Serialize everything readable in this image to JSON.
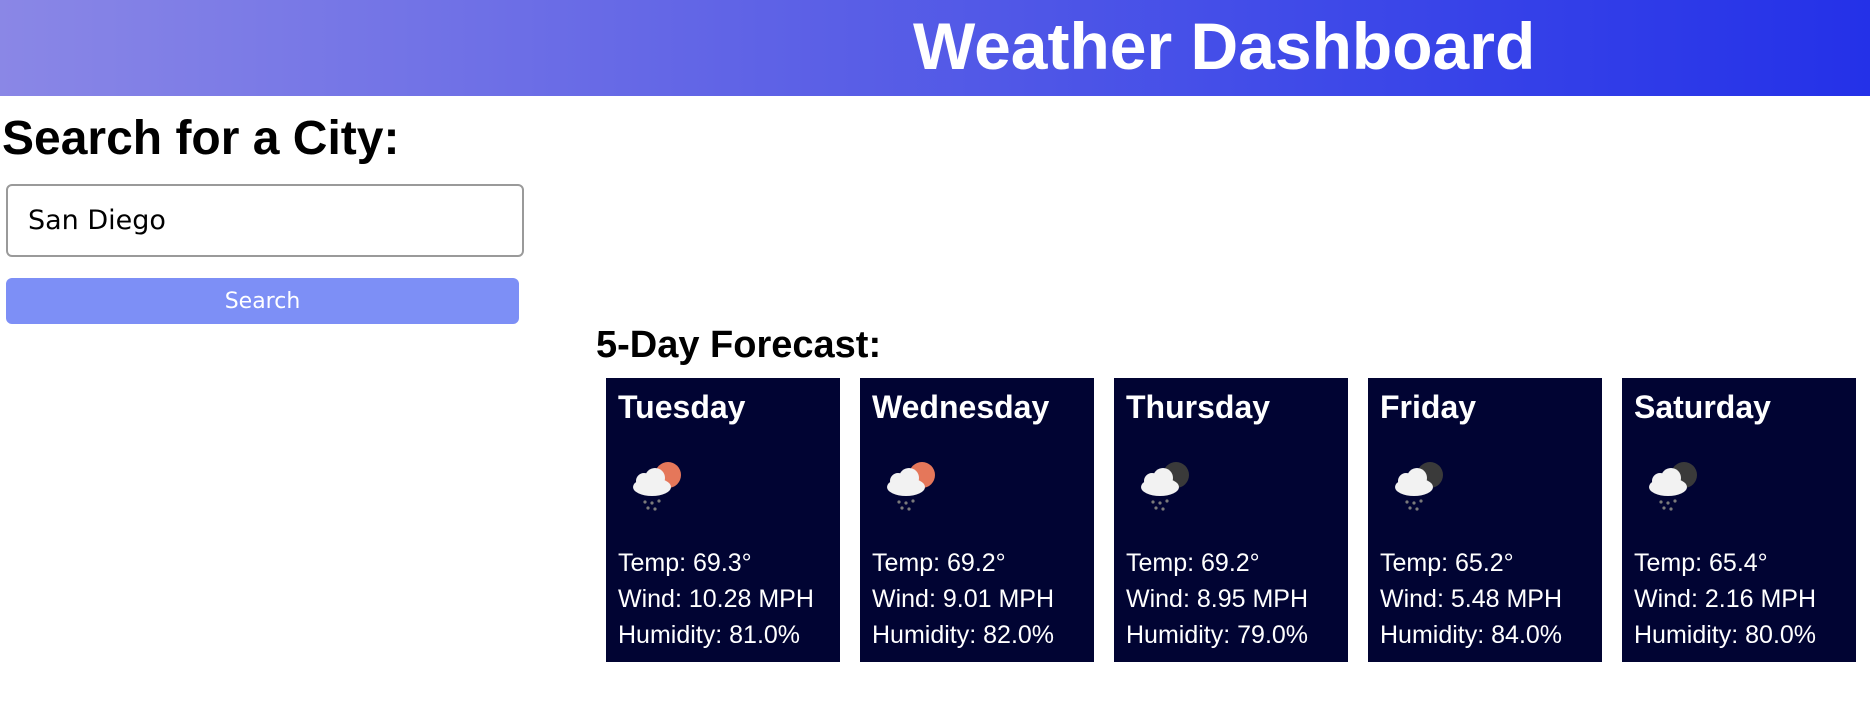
{
  "header": {
    "title": "Weather Dashboard"
  },
  "search": {
    "heading": "Search for a City:",
    "value": "San Diego",
    "button_label": "Search"
  },
  "forecast": {
    "heading": "5-Day Forecast:",
    "days": [
      {
        "day": "Tuesday",
        "icon": "rain-cloud-sun-icon",
        "temp": "Temp: 69.3°",
        "wind": "Wind: 10.28 MPH",
        "humidity": "Humidity: 81.0%"
      },
      {
        "day": "Wednesday",
        "icon": "rain-cloud-sun-icon",
        "temp": "Temp: 69.2°",
        "wind": "Wind: 9.01 MPH",
        "humidity": "Humidity: 82.0%"
      },
      {
        "day": "Thursday",
        "icon": "rain-cloud-moon-icon",
        "temp": "Temp: 69.2°",
        "wind": "Wind: 8.95 MPH",
        "humidity": "Humidity: 79.0%"
      },
      {
        "day": "Friday",
        "icon": "rain-cloud-moon-icon",
        "temp": "Temp: 65.2°",
        "wind": "Wind: 5.48 MPH",
        "humidity": "Humidity: 84.0%"
      },
      {
        "day": "Saturday",
        "icon": "rain-cloud-moon-icon",
        "temp": "Temp: 65.4°",
        "wind": "Wind: 2.16 MPH",
        "humidity": "Humidity: 80.0%"
      }
    ]
  },
  "colors": {
    "header_gradient_start": "#8a87e6",
    "header_gradient_end": "#2431e8",
    "card_background": "#010433",
    "button_background": "#7d8ff6",
    "sun": "#e5775a",
    "moon": "#3a3a3a"
  }
}
